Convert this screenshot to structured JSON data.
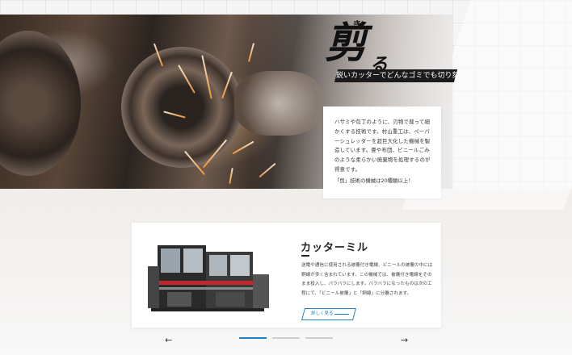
{
  "hero": {
    "title_kanji": "剪",
    "title_ruby": "き",
    "title_kana": "る",
    "tagline": "鋭いカッターでどんなゴミでも切り刻む"
  },
  "description": {
    "body": "ハサミや包丁のように、刃物で裁って細かくする技術です。村山重工は、ペーパーシュレッダーを超巨大化した機械を製造しています。畳や布団、ビニールごみのような柔らかい廃棄物を処理するのが得意です。",
    "note": "「剪」技術の機械は20種類以上！"
  },
  "product": {
    "name": "カッターミル",
    "text": "送電や通信に使用される被覆付き電線、ビニールの被覆の中には銅線が多く含まれています。この機械では、被覆付き電線をそのまま投入し、バラバラにします。バラバラになったものは次の工程にて、「ビニール被覆」と「銅線」に分離されます。",
    "more_label": "詳しく見る"
  },
  "carousel": {
    "prev_label": "←",
    "next_label": "→",
    "slides": 3,
    "active": 1
  },
  "colors": {
    "accent": "#1f7fc4",
    "dark": "#1a1a1a",
    "spark": "#ff9a3c"
  },
  "icons": [
    "arrow-left-icon",
    "arrow-right-icon",
    "long-arrow-icon"
  ]
}
